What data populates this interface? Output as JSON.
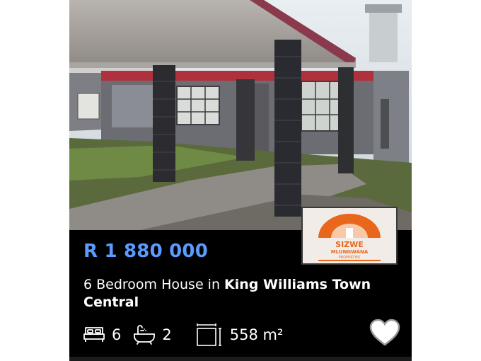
{
  "listing": {
    "price": "R 1 880 000",
    "title_prefix": "6 Bedroom House in ",
    "location": "King Williams Town Central",
    "features": {
      "bedrooms": "6",
      "bathrooms": "2",
      "floor_size": "558 m²"
    }
  },
  "agency_logo": {
    "line1": "SIZWE",
    "line2": "MLUNGWANA",
    "line3": "PROPERTIES"
  },
  "icons": {
    "bedroom": "bed-icon",
    "bathroom": "bath-icon",
    "floor_size": "floor-size-icon",
    "favourite": "heart-icon"
  },
  "colors": {
    "card_background": "#000000",
    "price": "#5b9bff",
    "text": "#ffffff",
    "logo_orange": "#e8671c"
  }
}
